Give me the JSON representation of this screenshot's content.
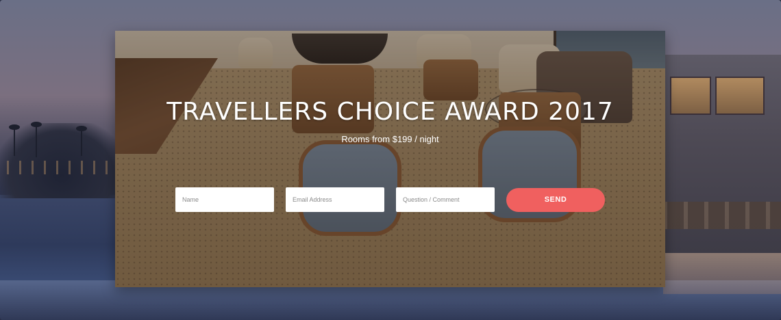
{
  "hero": {
    "title": "TRAVELLERS CHOICE AWARD 2017",
    "subtitle": "Rooms from $199 / night"
  },
  "form": {
    "name_placeholder": "Name",
    "email_placeholder": "Email Address",
    "comment_placeholder": "Question / Comment",
    "send_label": "SEND"
  },
  "colors": {
    "accent": "#f0605f",
    "title_text": "#ffffff"
  }
}
